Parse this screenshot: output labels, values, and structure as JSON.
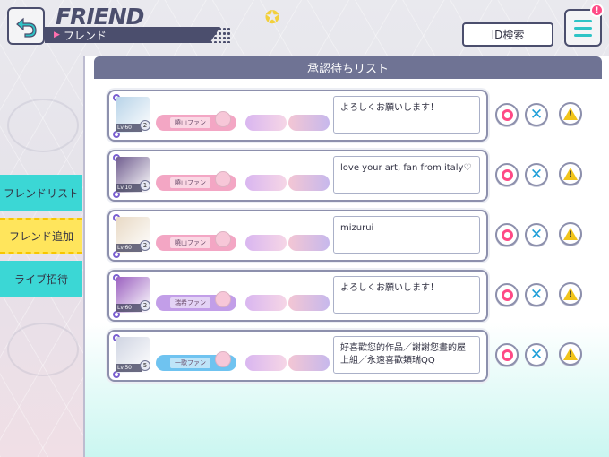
{
  "header": {
    "title": "FRIEND",
    "subtitle": "フレンド",
    "id_search_label": "ID検索",
    "notification_count": "!"
  },
  "side_tabs": [
    {
      "label": "フレンドリスト",
      "selected": false
    },
    {
      "label": "フレンド追加",
      "selected": true
    },
    {
      "label": "ライブ招待",
      "selected": false
    }
  ],
  "panel": {
    "title": "承認待ちリスト"
  },
  "requests": [
    {
      "level": "Lv.60",
      "rank": "2",
      "fan_label": "曉山ファン",
      "message": "よろしくお願いします！",
      "avatar_color": "#b7d3e8",
      "pill_color": "#f3a6c4"
    },
    {
      "level": "Lv.10",
      "rank": "1",
      "fan_label": "曉山ファン",
      "message": "love your art, fan from italy♡",
      "avatar_color": "#6f5c8e",
      "pill_color": "#f3a6c4"
    },
    {
      "level": "Lv.60",
      "rank": "2",
      "fan_label": "曉山ファン",
      "message": "mizurui",
      "avatar_color": "#e8d9c4",
      "pill_color": "#f3a6c4"
    },
    {
      "level": "Lv.60",
      "rank": "2",
      "fan_label": "瑞希ファン",
      "message": "よろしくお願いします！",
      "avatar_color": "#9a5fbf",
      "pill_color": "#c29ee8"
    },
    {
      "level": "Lv.50",
      "rank": "5",
      "fan_label": "一歌ファン",
      "message": "好喜歡您的作品／謝謝您畫的屋上組／永遠喜歡類瑞QQ",
      "avatar_color": "#cfd4e2",
      "pill_color": "#6fc3f0"
    }
  ],
  "colors": {
    "accent_cyan": "#3bd7d5",
    "accent_yellow": "#ffe55c",
    "accept_pink": "#ff4a86",
    "reject_blue": "#1e9fd8",
    "report_yellow": "#f1c41b",
    "frame_navy": "#4b4e6d"
  }
}
